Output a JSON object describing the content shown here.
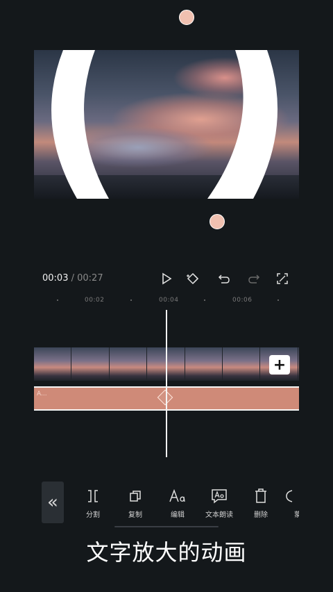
{
  "player": {
    "current_time": "00:03",
    "separator": " / ",
    "total_time": "00:27"
  },
  "ruler": {
    "labels": [
      "00:02",
      "00:04",
      "00:06"
    ]
  },
  "timeline": {
    "text_track_label": "A...",
    "add_clip_symbol": "+"
  },
  "toolbar": {
    "back_symbol": "«",
    "tools": [
      {
        "label": "分割",
        "icon": "split-icon"
      },
      {
        "label": "复制",
        "icon": "copy-icon"
      },
      {
        "label": "编辑",
        "icon": "edit-text-icon"
      },
      {
        "label": "文本朗读",
        "icon": "text-to-speech-icon"
      },
      {
        "label": "删除",
        "icon": "delete-icon"
      },
      {
        "label": "蒙",
        "icon": "more-icon"
      }
    ]
  },
  "caption": "文字放大的动画",
  "colors": {
    "background": "#14181b",
    "accent_track": "#cf8a78",
    "handle": "#f0c0b0"
  }
}
